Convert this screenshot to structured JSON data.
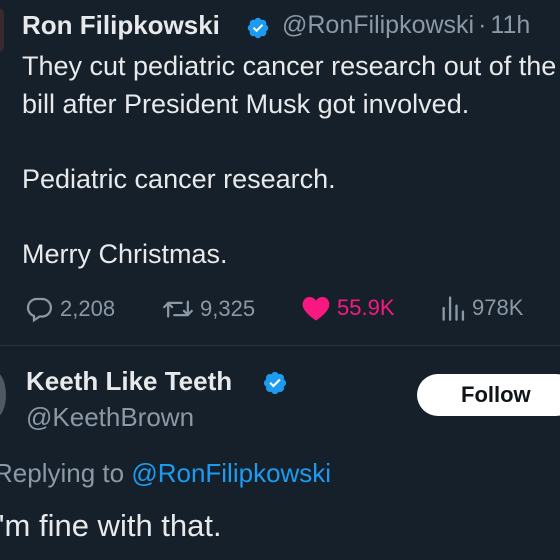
{
  "tweet": {
    "author_name": "Ron Filipkowski",
    "author_handle": "@RonFilipkowski",
    "time_separator": "·",
    "time": "11h",
    "verified_icon": "verified-badge-icon",
    "text_lines": [
      "They cut pediatric cancer research out of the",
      "bill after President Musk got involved.",
      "Pediatric cancer research.",
      "Merry Christmas."
    ],
    "stats": {
      "replies": "2,208",
      "reposts": "9,325",
      "likes": "55.9K",
      "views": "978K"
    },
    "colors": {
      "like": "#f91880",
      "muted": "#8b98a5",
      "link": "#1d9bf0",
      "background": "#15202b"
    }
  },
  "reply": {
    "author_name": "Keeth Like Teeth",
    "author_handle": "@KeethBrown",
    "follow_label": "Follow",
    "replying_prefix": "Replying to",
    "replying_to": "@RonFilipkowski",
    "text": "I'm fine with that."
  }
}
